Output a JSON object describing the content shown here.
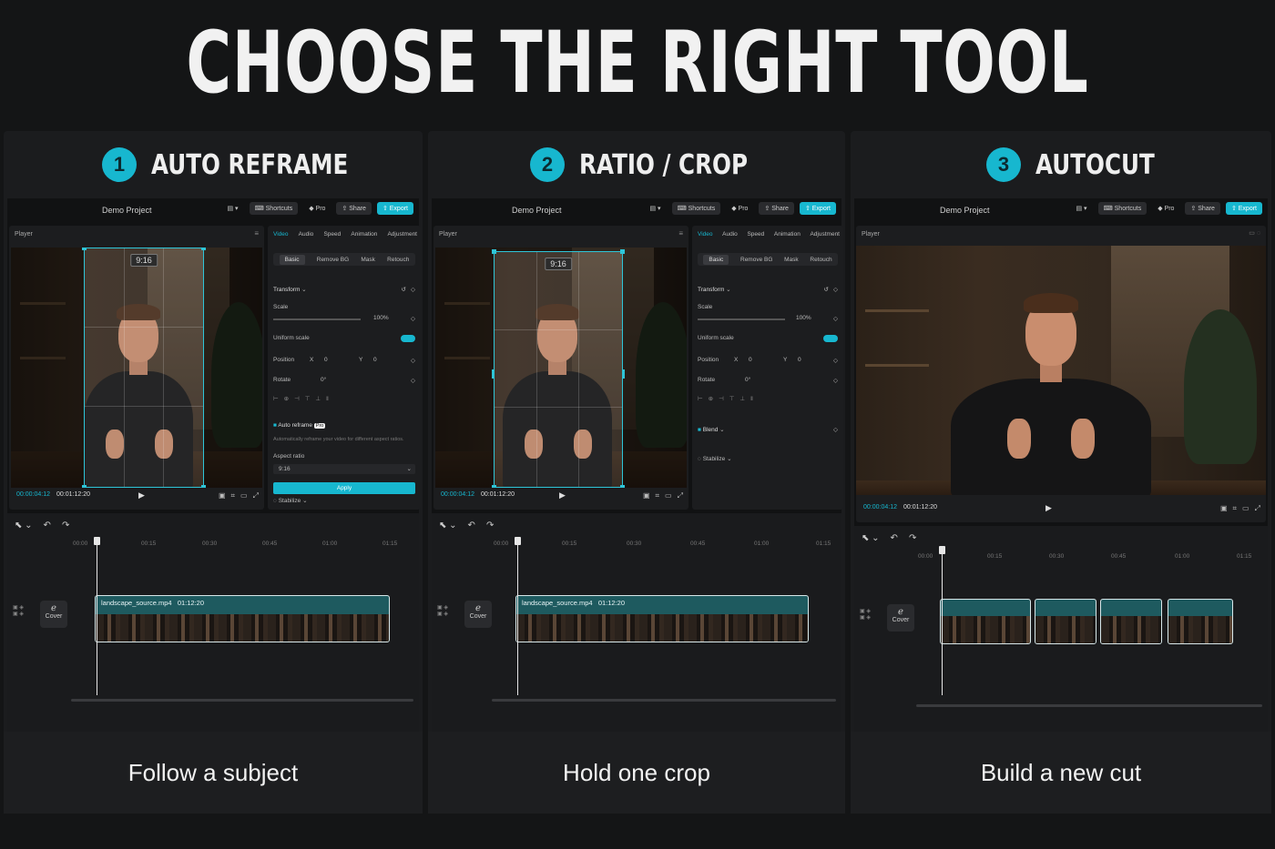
{
  "headline": "CHOOSE THE RIGHT TOOL",
  "panels": [
    {
      "number": "1",
      "title": "AUTO REFRAME",
      "caption": "Follow a subject",
      "project": "Demo Project",
      "toolbar": {
        "shortcuts": "Shortcuts",
        "pro": "Pro",
        "share": "Share",
        "export": "Export"
      },
      "player_label": "Player",
      "ratio_tag": "9:16",
      "timecode_current": "00:00:04:12",
      "timecode_total": "00:01:12:20",
      "tabs": [
        "Video",
        "Audio",
        "Speed",
        "Animation",
        "Adjustment"
      ],
      "subtabs": [
        "Basic",
        "Remove BG",
        "Mask",
        "Retouch"
      ],
      "transform": "Transform",
      "scale_label": "Scale",
      "scale_value": "100%",
      "uniform": "Uniform scale",
      "position": "Position",
      "pos_x": "X",
      "pos_x_val": "0",
      "pos_y": "Y",
      "pos_y_val": "0",
      "rotate": "Rotate",
      "rotate_val": "0°",
      "auto_reframe": "Auto reframe",
      "pro_tag": "Pro",
      "auto_desc": "Automatically reframe your video for different aspect ratios.",
      "aspect_label": "Aspect ratio",
      "aspect_value": "9:16",
      "apply": "Apply",
      "stabilize": "Stabilize",
      "ruler": [
        "00:00",
        "00:15",
        "00:30",
        "00:45",
        "01:00",
        "01:15"
      ],
      "cover": "Cover",
      "clip_name": "landscape_source.mp4",
      "clip_dur": "01:12:20"
    },
    {
      "number": "2",
      "title": "RATIO / CROP",
      "caption": "Hold one crop",
      "project": "Demo Project",
      "toolbar": {
        "shortcuts": "Shortcuts",
        "pro": "Pro",
        "share": "Share",
        "export": "Export"
      },
      "player_label": "Player",
      "ratio_tag": "9:16",
      "timecode_current": "00:00:04:12",
      "timecode_total": "00:01:12:20",
      "tabs": [
        "Video",
        "Audio",
        "Speed",
        "Animation",
        "Adjustment"
      ],
      "subtabs": [
        "Basic",
        "Remove BG",
        "Mask",
        "Retouch"
      ],
      "transform": "Transform",
      "scale_label": "Scale",
      "scale_value": "100%",
      "uniform": "Uniform scale",
      "position": "Position",
      "pos_x": "X",
      "pos_x_val": "0",
      "pos_y": "Y",
      "pos_y_val": "0",
      "rotate": "Rotate",
      "rotate_val": "0°",
      "blend": "Blend",
      "stabilize": "Stabilize",
      "ruler": [
        "00:00",
        "00:15",
        "00:30",
        "00:45",
        "01:00",
        "01:15"
      ],
      "cover": "Cover",
      "clip_name": "landscape_source.mp4",
      "clip_dur": "01:12:20"
    },
    {
      "number": "3",
      "title": "AUTOCUT",
      "caption": "Build a new cut",
      "project": "Demo Project",
      "toolbar": {
        "shortcuts": "Shortcuts",
        "pro": "Pro",
        "share": "Share",
        "export": "Export"
      },
      "player_label": "Player",
      "timecode_current": "00:00:04:12",
      "timecode_total": "00:01:12:20",
      "ruler": [
        "00:00",
        "00:15",
        "00:30",
        "00:45",
        "01:00",
        "01:15"
      ],
      "cover": "Cover"
    }
  ],
  "colors": {
    "accent": "#17b7cf",
    "background": "#141516",
    "panel": "#1b1c1e"
  }
}
